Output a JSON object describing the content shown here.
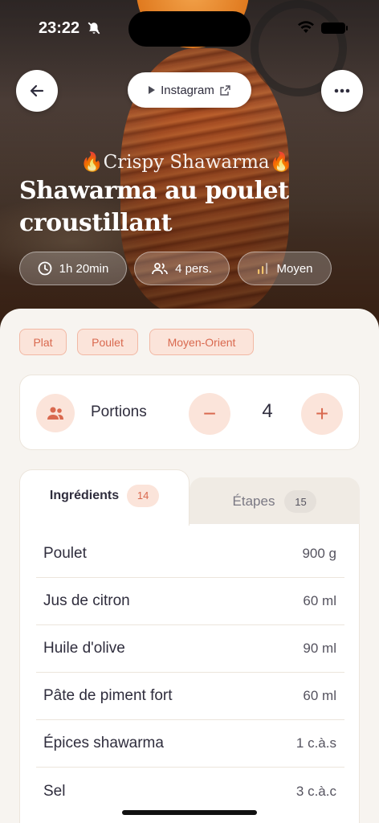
{
  "status_bar": {
    "time": "23:22"
  },
  "header": {
    "source_label": "Instagram",
    "subtitle": "🔥Crispy Shawarma🔥",
    "title": "Shawarma au poulet croustillant"
  },
  "meta": {
    "time": "1h 20min",
    "servings": "4 pers.",
    "difficulty": "Moyen"
  },
  "tags": [
    "Plat",
    "Poulet",
    "Moyen-Orient"
  ],
  "portions": {
    "label": "Portions",
    "value": "4",
    "minus": "−",
    "plus": "+"
  },
  "tabs": [
    {
      "label": "Ingrédients",
      "count": "14",
      "active": true
    },
    {
      "label": "Étapes",
      "count": "15",
      "active": false
    }
  ],
  "ingredients": [
    {
      "name": "Poulet",
      "qty": "900 g"
    },
    {
      "name": "Jus de citron",
      "qty": "60 ml"
    },
    {
      "name": "Huile d'olive",
      "qty": "90 ml"
    },
    {
      "name": "Pâte de piment fort",
      "qty": "60 ml"
    },
    {
      "name": "Épices shawarma",
      "qty": "1 c.à.s"
    },
    {
      "name": "Sel",
      "qty": "3 c.à.c"
    }
  ],
  "colors": {
    "accent": "#d9694f",
    "accent_soft": "#fbe4da",
    "background": "#f7f4f0"
  }
}
